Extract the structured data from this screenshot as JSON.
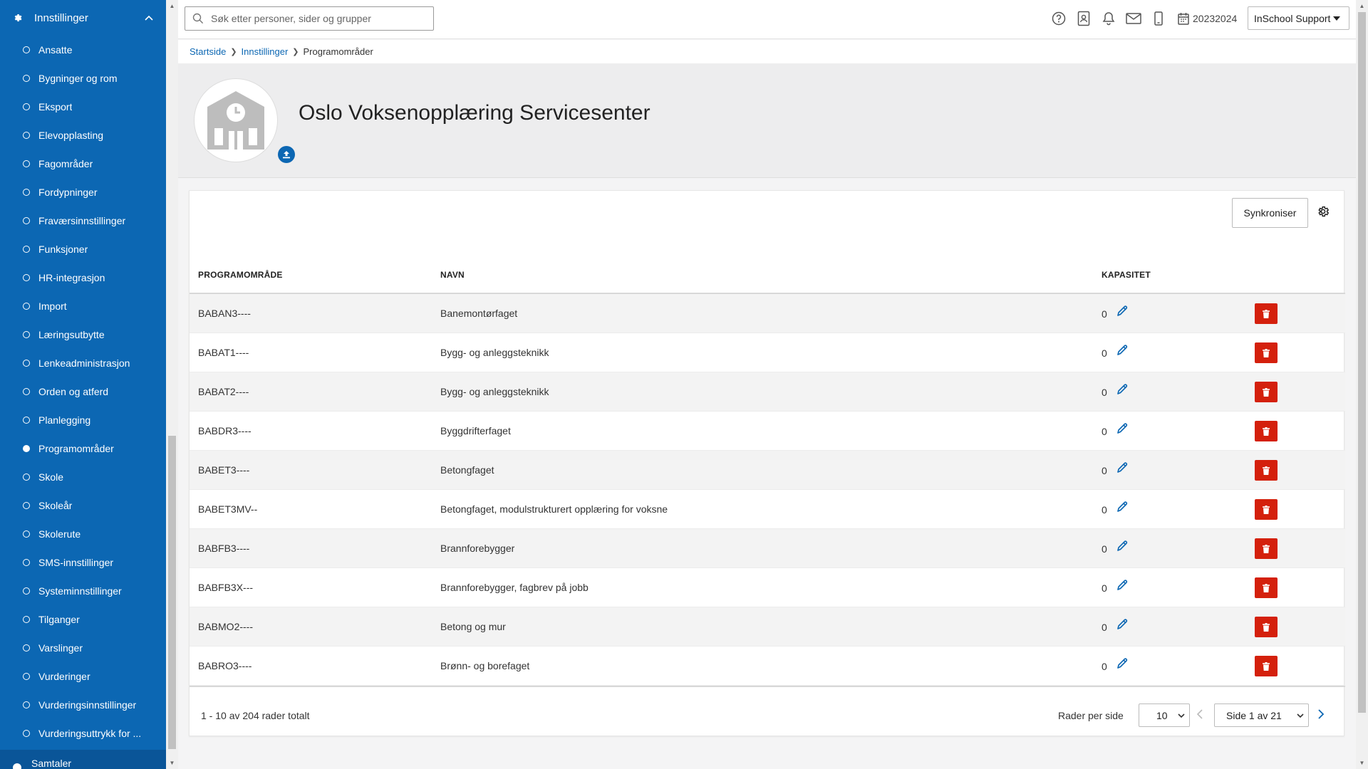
{
  "sidebar": {
    "header": "Innstillinger",
    "items": [
      {
        "label": "Ansatte",
        "active": false
      },
      {
        "label": "Bygninger og rom",
        "active": false
      },
      {
        "label": "Eksport",
        "active": false
      },
      {
        "label": "Elevopplasting",
        "active": false
      },
      {
        "label": "Fagområder",
        "active": false
      },
      {
        "label": "Fordypninger",
        "active": false
      },
      {
        "label": "Fraværsinnstillinger",
        "active": false
      },
      {
        "label": "Funksjoner",
        "active": false
      },
      {
        "label": "HR-integrasjon",
        "active": false
      },
      {
        "label": "Import",
        "active": false
      },
      {
        "label": "Læringsutbytte",
        "active": false
      },
      {
        "label": "Lenkeadministrasjon",
        "active": false
      },
      {
        "label": "Orden og atferd",
        "active": false
      },
      {
        "label": "Planlegging",
        "active": false
      },
      {
        "label": "Programområder",
        "active": true
      },
      {
        "label": "Skole",
        "active": false
      },
      {
        "label": "Skoleår",
        "active": false
      },
      {
        "label": "Skolerute",
        "active": false
      },
      {
        "label": "SMS-innstillinger",
        "active": false
      },
      {
        "label": "Systeminnstillinger",
        "active": false
      },
      {
        "label": "Tilganger",
        "active": false
      },
      {
        "label": "Varslinger",
        "active": false
      },
      {
        "label": "Vurderinger",
        "active": false
      },
      {
        "label": "Vurderingsinnstillinger",
        "active": false
      },
      {
        "label": "Vurderingsuttrykk for ...",
        "active": false
      }
    ],
    "bottom_label": "Samtaler"
  },
  "topbar": {
    "search_placeholder": "Søk etter personer, sider og grupper",
    "school_year": "20232024",
    "user_menu": "InSchool Support"
  },
  "breadcrumb": {
    "items": [
      "Startside",
      "Innstillinger"
    ],
    "current": "Programområder"
  },
  "org": {
    "title": "Oslo Voksenopplæring Servicesenter"
  },
  "toolbar": {
    "sync_label": "Synkroniser"
  },
  "table": {
    "headers": {
      "code": "PROGRAMOMRÅDE",
      "name": "NAVN",
      "capacity": "KAPASITET"
    },
    "rows": [
      {
        "code": "BABAN3----",
        "name": "Banemontørfaget",
        "capacity": "0"
      },
      {
        "code": "BABAT1----",
        "name": "Bygg- og anleggsteknikk",
        "capacity": "0"
      },
      {
        "code": "BABAT2----",
        "name": "Bygg- og anleggsteknikk",
        "capacity": "0"
      },
      {
        "code": "BABDR3----",
        "name": "Byggdrifterfaget",
        "capacity": "0"
      },
      {
        "code": "BABET3----",
        "name": "Betongfaget",
        "capacity": "0"
      },
      {
        "code": "BABET3MV--",
        "name": "Betongfaget, modulstrukturert opplæring for voksne",
        "capacity": "0"
      },
      {
        "code": "BABFB3----",
        "name": "Brannforebygger",
        "capacity": "0"
      },
      {
        "code": "BABFB3X---",
        "name": "Brannforebygger, fagbrev på jobb",
        "capacity": "0"
      },
      {
        "code": "BABMO2----",
        "name": "Betong og mur",
        "capacity": "0"
      },
      {
        "code": "BABRO3----",
        "name": "Brønn- og borefaget",
        "capacity": "0"
      }
    ]
  },
  "pagination": {
    "total_text": "1 - 10 av 204 rader totalt",
    "rows_per_page_label": "Rader per side",
    "rows_per_page": "10",
    "page_text": "Side 1 av 21"
  },
  "colors": {
    "sidebar": "#0c67b3",
    "delete": "#d4200c",
    "link": "#0c67b3"
  }
}
